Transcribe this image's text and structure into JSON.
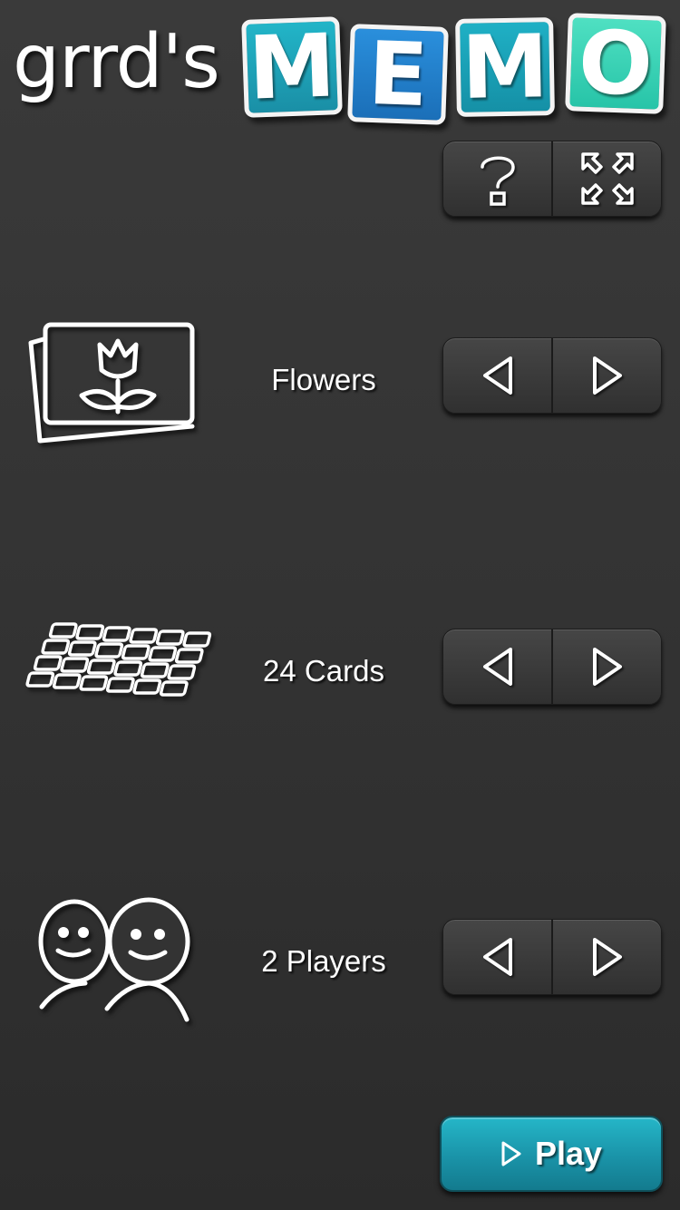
{
  "logo": {
    "prefix": "grrd's",
    "letters": [
      "M",
      "E",
      "M",
      "O"
    ]
  },
  "toolbar": {
    "help_icon": "question-mark-icon",
    "fullscreen_icon": "expand-arrows-icon"
  },
  "settings": [
    {
      "id": "theme",
      "label": "Flowers",
      "icon": "flower-cards-icon"
    },
    {
      "id": "cards",
      "label": "24 Cards",
      "icon": "card-grid-icon"
    },
    {
      "id": "players",
      "label": "2 Players",
      "icon": "two-players-icon"
    }
  ],
  "play_button": {
    "label": "Play",
    "icon": "play-triangle-icon"
  },
  "colors": {
    "background": "#333333",
    "tile_cyan": "#1fb0c5",
    "tile_blue": "#1b6fb8",
    "tile_mint": "#27c4a8",
    "play_button": "#1a93a8"
  }
}
